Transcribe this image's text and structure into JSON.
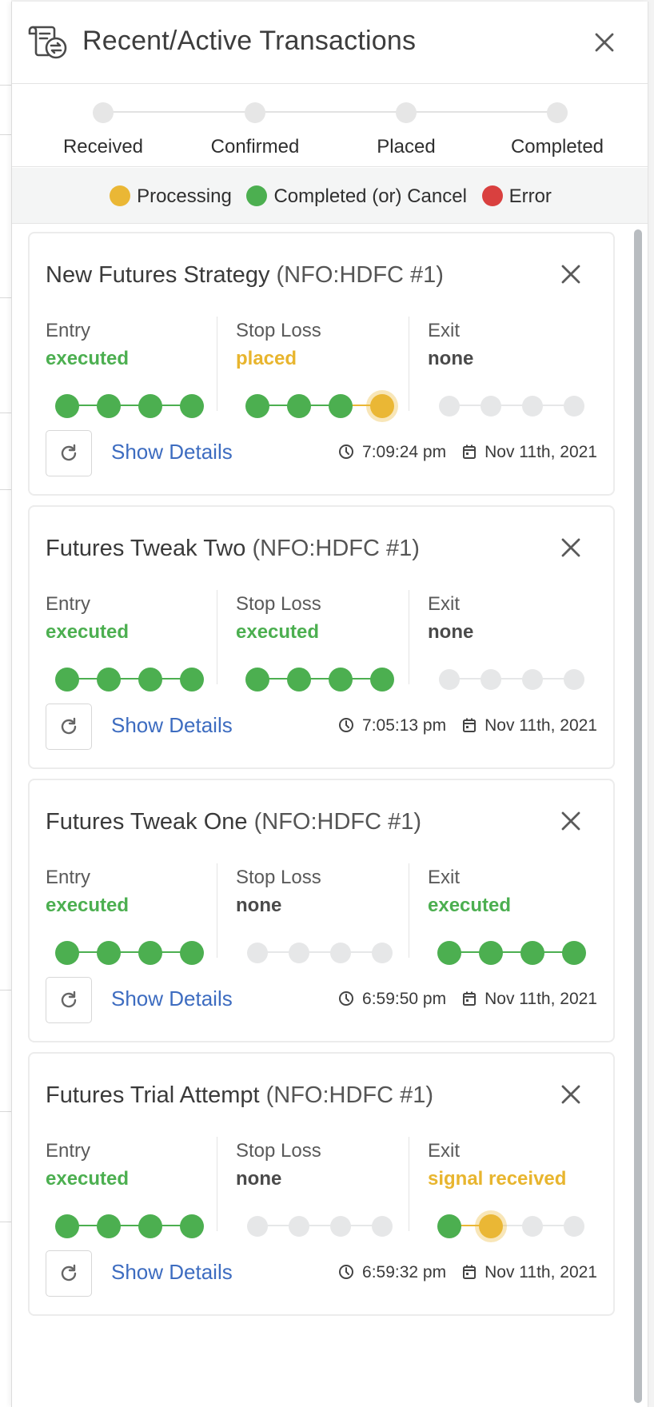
{
  "header": {
    "title": "Recent/Active Transactions",
    "icon": "transactions-icon",
    "close_icon": "close-icon"
  },
  "stepper": {
    "steps": [
      "Received",
      "Confirmed",
      "Placed",
      "Completed"
    ]
  },
  "legend": {
    "items": [
      {
        "label": "Processing",
        "color": "#eab735"
      },
      {
        "label": "Completed (or) Cancel",
        "color": "#4caf50"
      },
      {
        "label": "Error",
        "color": "#d9403f"
      }
    ]
  },
  "colors": {
    "green": "#4caf50",
    "yellow": "#eab735",
    "grey": "#e6e7e8",
    "link": "#3d6cc0"
  },
  "transactions": [
    {
      "name": "New Futures Strategy",
      "symbol": "(NFO:HDFC  #1)",
      "entry": {
        "label": "Entry",
        "status": "executed",
        "progress": [
          "green",
          "green",
          "green",
          "green"
        ]
      },
      "stop_loss": {
        "label": "Stop Loss",
        "status": "placed",
        "progress": [
          "green",
          "green",
          "green",
          "yellow"
        ]
      },
      "exit": {
        "label": "Exit",
        "status": "none",
        "progress": [
          "grey",
          "grey",
          "grey",
          "grey"
        ]
      },
      "show_details": "Show Details",
      "time": "7:09:24 pm",
      "date": "Nov 11th, 2021"
    },
    {
      "name": "Futures Tweak Two",
      "symbol": "(NFO:HDFC  #1)",
      "entry": {
        "label": "Entry",
        "status": "executed",
        "progress": [
          "green",
          "green",
          "green",
          "green"
        ]
      },
      "stop_loss": {
        "label": "Stop Loss",
        "status": "executed",
        "progress": [
          "green",
          "green",
          "green",
          "green"
        ]
      },
      "exit": {
        "label": "Exit",
        "status": "none",
        "progress": [
          "grey",
          "grey",
          "grey",
          "grey"
        ]
      },
      "show_details": "Show Details",
      "time": "7:05:13 pm",
      "date": "Nov 11th, 2021"
    },
    {
      "name": "Futures Tweak One",
      "symbol": "(NFO:HDFC  #1)",
      "entry": {
        "label": "Entry",
        "status": "executed",
        "progress": [
          "green",
          "green",
          "green",
          "green"
        ]
      },
      "stop_loss": {
        "label": "Stop Loss",
        "status": "none",
        "progress": [
          "grey",
          "grey",
          "grey",
          "grey"
        ]
      },
      "exit": {
        "label": "Exit",
        "status": "executed",
        "progress": [
          "green",
          "green",
          "green",
          "green"
        ]
      },
      "show_details": "Show Details",
      "time": "6:59:50 pm",
      "date": "Nov 11th, 2021"
    },
    {
      "name": "Futures Trial Attempt",
      "symbol": "(NFO:HDFC  #1)",
      "entry": {
        "label": "Entry",
        "status": "executed",
        "progress": [
          "green",
          "green",
          "green",
          "green"
        ]
      },
      "stop_loss": {
        "label": "Stop Loss",
        "status": "none",
        "progress": [
          "grey",
          "grey",
          "grey",
          "grey"
        ]
      },
      "exit": {
        "label": "Exit",
        "status": "signal received",
        "progress": [
          "green",
          "yellow",
          "grey",
          "grey"
        ]
      },
      "show_details": "Show Details",
      "time": "6:59:32 pm",
      "date": "Nov 11th, 2021"
    }
  ]
}
